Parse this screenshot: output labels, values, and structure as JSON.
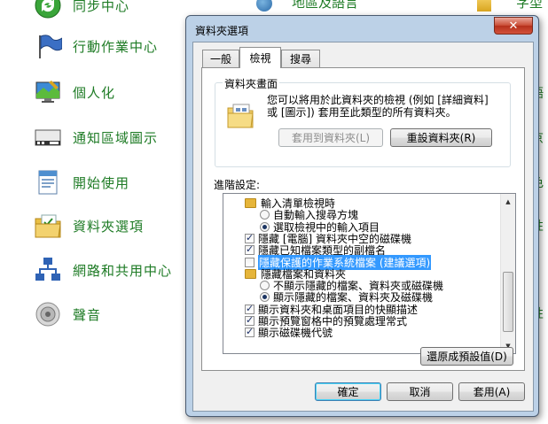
{
  "control_panel": {
    "items": [
      {
        "label": "同步中心",
        "icon": "sync-center-icon"
      },
      {
        "label": "行動作業中心",
        "icon": "action-center-flag-icon"
      },
      {
        "label": "個人化",
        "icon": "personalization-icon"
      },
      {
        "label": "通知區域圖示",
        "icon": "notification-area-icon"
      },
      {
        "label": "開始使用",
        "icon": "getting-started-icon"
      },
      {
        "label": "資料夾選項",
        "icon": "folder-options-icon"
      },
      {
        "label": "網路和共用中心",
        "icon": "network-sharing-icon"
      },
      {
        "label": "聲音",
        "icon": "sound-icon"
      }
    ],
    "column2_top": "地區及語言",
    "column3_top": "字型",
    "right_edge": [
      "語",
      "京",
      "色",
      "性",
      "性"
    ]
  },
  "dialog": {
    "title": "資料夾選項",
    "close_glyph": "✕",
    "tabs": [
      "一般",
      "檢視",
      "搜尋"
    ],
    "active_tab": 1,
    "folder_views": {
      "title": "資料夾畫面",
      "description_line1": "您可以將用於此資料夾的檢視 (例如 [詳細資料]",
      "description_line2": "或 [圖示]) 套用至此類型的所有資料夾。",
      "apply_button": "套用到資料夾(L)",
      "reset_button": "重設資料夾(R)"
    },
    "advanced_label": "進階設定:",
    "tree": [
      {
        "type": "folder",
        "level": 0,
        "label": "輸入清單檢視時"
      },
      {
        "type": "radio",
        "level": 1,
        "checked": false,
        "label": "自動輸入搜尋方塊"
      },
      {
        "type": "radio",
        "level": 1,
        "checked": true,
        "label": "選取檢視中的輸入項目"
      },
      {
        "type": "checkbox",
        "level": 0,
        "checked": true,
        "label": "隱藏 [電腦] 資料夾中空的磁碟機"
      },
      {
        "type": "checkbox",
        "level": 0,
        "checked": true,
        "label": "隱藏已知檔案類型的副檔名"
      },
      {
        "type": "checkbox",
        "level": 0,
        "checked": false,
        "selected": true,
        "label": "隱藏保護的作業系統檔案 (建議選項)"
      },
      {
        "type": "folder",
        "level": 0,
        "label": "隱藏檔案和資料夾"
      },
      {
        "type": "radio",
        "level": 1,
        "checked": false,
        "label": "不顯示隱藏的檔案、資料夾或磁碟機"
      },
      {
        "type": "radio",
        "level": 1,
        "checked": true,
        "label": "顯示隱藏的檔案、資料夾及磁碟機"
      },
      {
        "type": "checkbox",
        "level": 0,
        "checked": true,
        "label": "顯示資料夾和桌面項目的快顯描述"
      },
      {
        "type": "checkbox",
        "level": 0,
        "checked": true,
        "label": "顯示預覽窗格中的預覽處理常式"
      },
      {
        "type": "checkbox",
        "level": 0,
        "checked": true,
        "label": "顯示磁碟機代號"
      }
    ],
    "restore_button": "還原成預設值(D)",
    "ok_button": "確定",
    "cancel_button": "取消",
    "apply_button": "套用(A)"
  }
}
